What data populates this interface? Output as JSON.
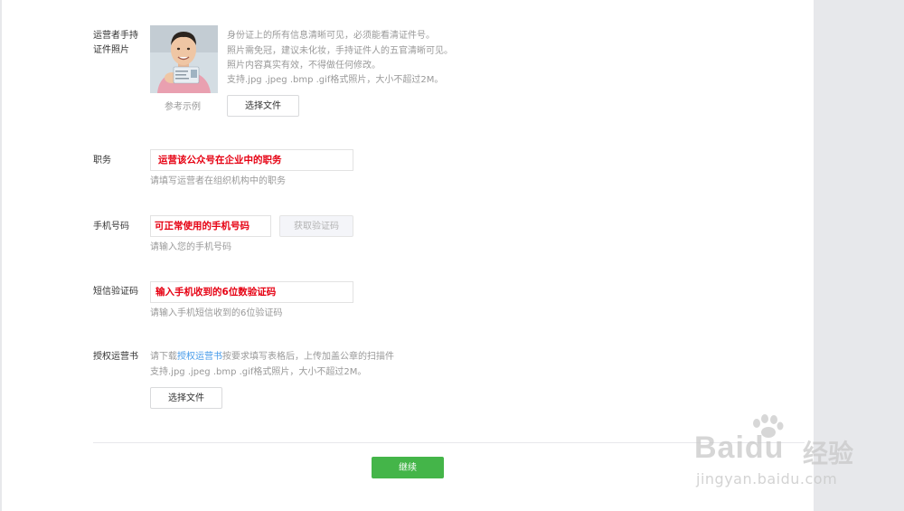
{
  "id_photo": {
    "label_line1": "运营者手持",
    "label_line2": "证件照片",
    "caption": "参考示例",
    "hints": [
      "身份证上的所有信息清晰可见，必须能看清证件号。",
      "照片需免冠，建议未化妆，手持证件人的五官清晰可见。",
      "照片内容真实有效，不得做任何修改。",
      "支持.jpg .jpeg .bmp .gif格式照片，大小不超过2M。"
    ],
    "upload_button": "选择文件"
  },
  "position": {
    "label": "职务",
    "value": "运营该公众号在企业中的职务",
    "hint": "请填写运营者在组织机构中的职务"
  },
  "phone": {
    "label": "手机号码",
    "value": "可正常使用的手机号码",
    "code_button": "获取验证码",
    "hint": "请输入您的手机号码"
  },
  "sms": {
    "label": "短信验证码",
    "value": "输入手机收到的6位数验证码",
    "hint": "请输入手机短信收到的6位验证码"
  },
  "authorization": {
    "label": "授权运营书",
    "hint_prefix": "请下载",
    "hint_link": "授权运营书",
    "hint_suffix": "按要求填写表格后，上传加盖公章的扫描件",
    "hint_line2": "支持.jpg .jpeg .bmp .gif格式照片，大小不超过2M。",
    "upload_button": "选择文件"
  },
  "continue_button": "继续",
  "watermark": {
    "brand": "Baidu",
    "cn": "经验",
    "url": "jingyan.baidu.com"
  },
  "colors": {
    "primary": "#44b549",
    "highlight": "#e60012",
    "link": "#459ae9"
  }
}
